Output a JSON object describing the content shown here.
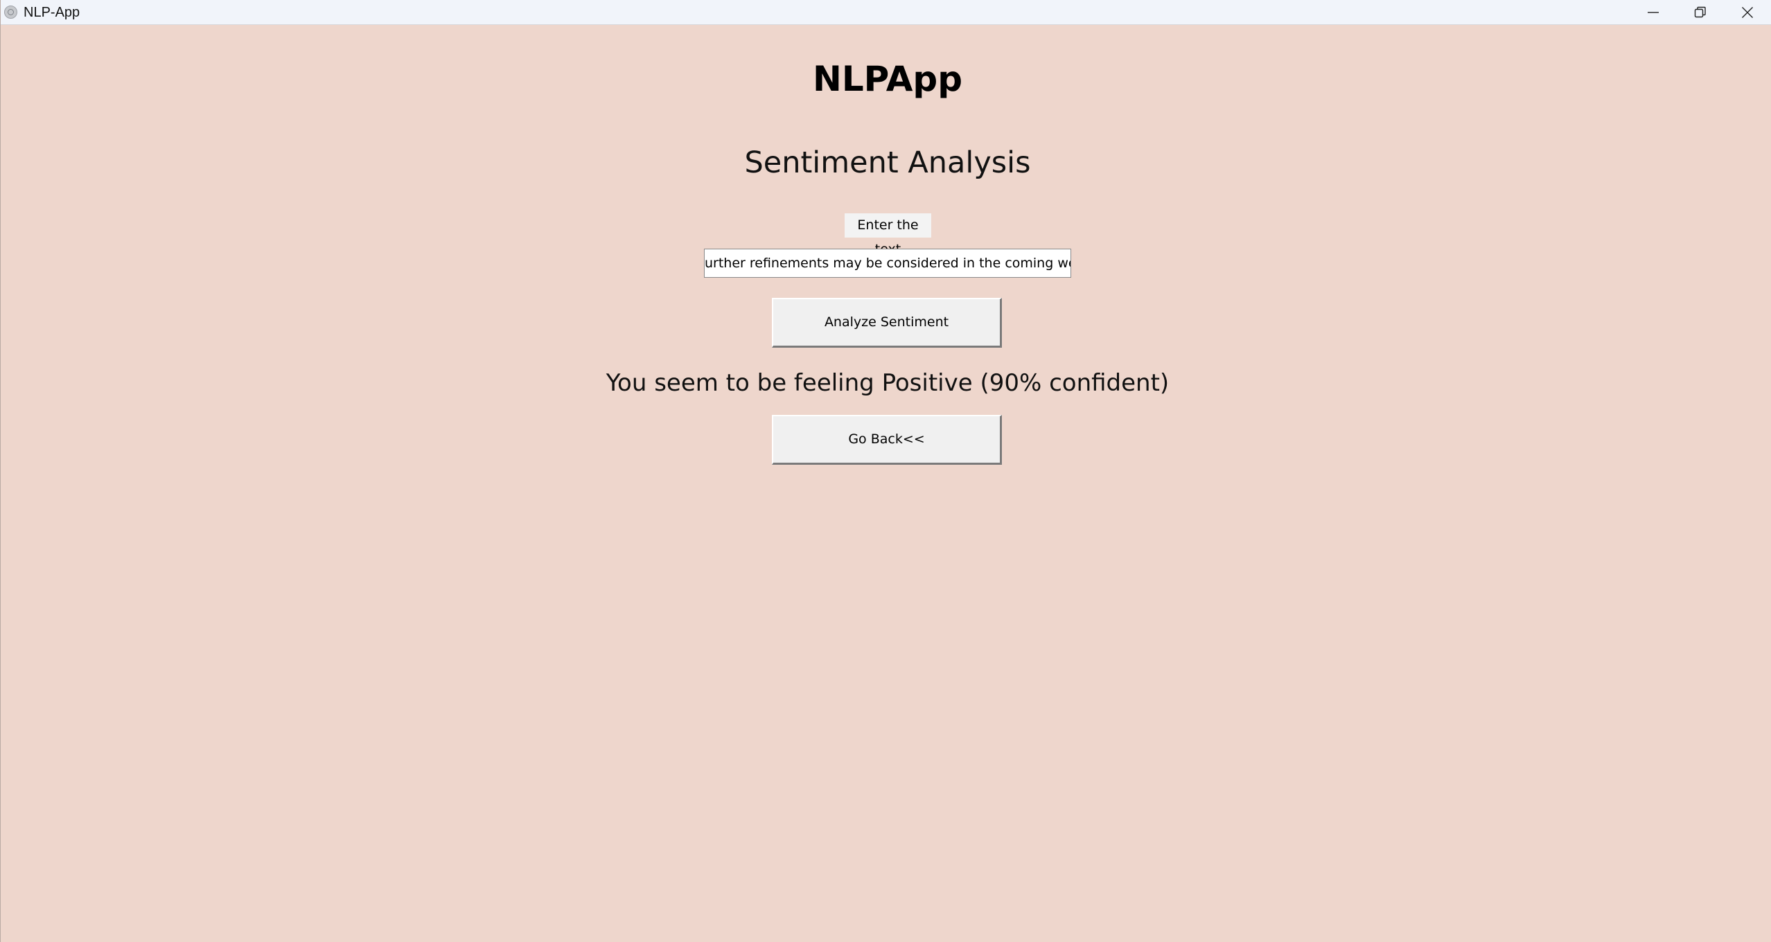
{
  "window": {
    "title": "NLP-App",
    "controls": {
      "minimize_icon": "minimize-icon",
      "maximize_icon": "restore-icon",
      "close_icon": "close-icon"
    }
  },
  "main": {
    "app_title": "NLPApp",
    "page_title": "Sentiment Analysis",
    "input_label": "Enter the text",
    "input_value": "urther refinements may be considered in the coming weeks.",
    "analyze_button": "Analyze Sentiment",
    "result": "You seem to be feeling Positive (90% confident)",
    "back_button": "Go Back<<"
  },
  "colors": {
    "background": "#eed6cc",
    "titlebar": "#f1f4fa",
    "button_face": "#f0f0f0",
    "entry_background": "#ffffff"
  }
}
